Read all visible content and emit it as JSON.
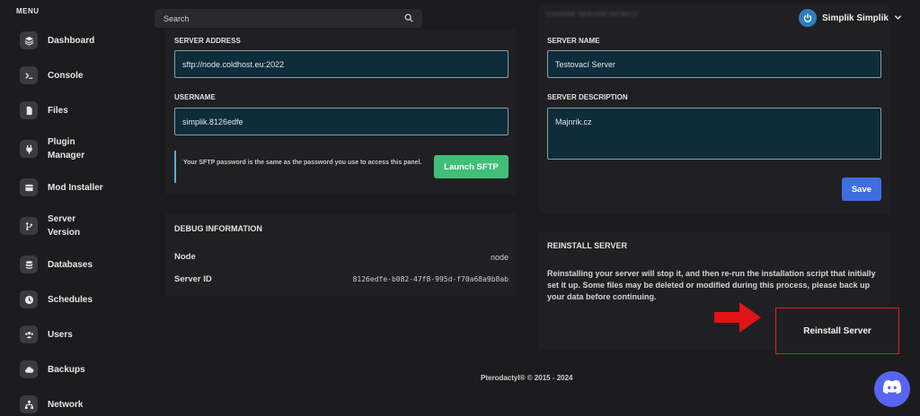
{
  "sidebar": {
    "title": "MENU",
    "items": [
      {
        "label": "Dashboard",
        "icon": "layers-icon"
      },
      {
        "label": "Console",
        "icon": "terminal-icon"
      },
      {
        "label": "Files",
        "icon": "file-icon"
      },
      {
        "label": "Plugin Manager",
        "icon": "plug-icon"
      },
      {
        "label": "Mod Installer",
        "icon": "box-icon"
      },
      {
        "label": "Server Version",
        "icon": "branch-icon"
      },
      {
        "label": "Databases",
        "icon": "database-icon"
      },
      {
        "label": "Schedules",
        "icon": "clock-icon"
      },
      {
        "label": "Users",
        "icon": "users-icon"
      },
      {
        "label": "Backups",
        "icon": "cloud-icon"
      },
      {
        "label": "Network",
        "icon": "network-icon"
      }
    ]
  },
  "search": {
    "placeholder": "Search"
  },
  "sftp": {
    "address_label": "SERVER ADDRESS",
    "address_value": "sftp://node.coldhost.eu:2022",
    "username_label": "USERNAME",
    "username_value": "simplik.8126edfe",
    "info_text": "Your SFTP password is the same as the password you use to access this panel.",
    "launch_label": "Launch SFTP"
  },
  "debug": {
    "title": "DEBUG INFORMATION",
    "node_label": "Node",
    "node_value": "node",
    "server_id_label": "Server ID",
    "server_id_value": "8126edfe-b082-47f8-995d-f70a68a9b8ab"
  },
  "details": {
    "blurred_title": "CHANGE SERVER DETAILS",
    "name_label": "SERVER NAME",
    "name_value": "Testovací Server",
    "description_label": "SERVER DESCRIPTION",
    "description_value": "Majnrik.cz",
    "save_label": "Save"
  },
  "reinstall": {
    "title": "REINSTALL SERVER",
    "text": "Reinstalling your server will stop it, and then re-run the installation script that initially set it up. Some files may be deleted or modified during this process, please back up your data before continuing.",
    "button_label": "Reinstall Server"
  },
  "user": {
    "name": "Simplik Simplik"
  },
  "footer": {
    "text": "Pterodactyl® © 2015 - 2024"
  },
  "colors": {
    "accent_green": "#3fbf78",
    "accent_blue": "#3f6ee0",
    "highlight_red": "#e02020",
    "discord": "#5865f2"
  }
}
